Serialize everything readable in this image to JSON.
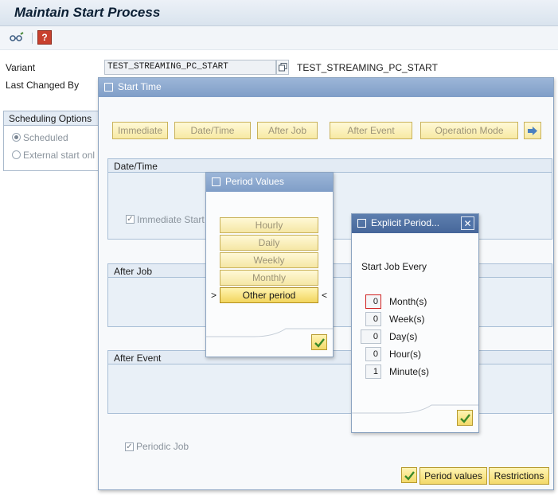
{
  "window": {
    "title": "Maintain Start Process"
  },
  "toolbar": {
    "icons": [
      "glasses-icon",
      "help-icon"
    ],
    "help_glyph": "?"
  },
  "form": {
    "variant_label": "Variant",
    "variant_value": "TEST_STREAMING_PC_START",
    "variant_desc": "TEST_STREAMING_PC_START",
    "last_changed_label": "Last Changed By"
  },
  "scheduling": {
    "header": "Scheduling Options",
    "options": [
      "Scheduled",
      "External start onl"
    ]
  },
  "start_time": {
    "title": "Start Time",
    "buttons": [
      "Immediate",
      "Date/Time",
      "After Job",
      "After Event",
      "Operation Mode"
    ],
    "groups": {
      "datetime": "Date/Time",
      "afterjob": "After Job",
      "afterevent": "After Event"
    },
    "immediate_start": "Immediate Start",
    "periodic_job": "Periodic Job",
    "footer_buttons": {
      "period_values": "Period values",
      "restrictions": "Restrictions"
    }
  },
  "period_values": {
    "title": "Period Values",
    "options": [
      "Hourly",
      "Daily",
      "Weekly",
      "Monthly",
      "Other period"
    ],
    "selected_markers": {
      "left": ">",
      "right": "<"
    }
  },
  "explicit_period": {
    "title": "Explicit Period...",
    "prompt": "Start Job Every",
    "rows": [
      {
        "value": "0",
        "unit": "Month(s)"
      },
      {
        "value": "0",
        "unit": "Week(s)"
      },
      {
        "value": "0",
        "unit": "Day(s)"
      },
      {
        "value": "0",
        "unit": "Hour(s)"
      },
      {
        "value": "1",
        "unit": "Minute(s)"
      }
    ]
  },
  "colors": {
    "title_bar": "#7f9ec7",
    "button_yellow": "#f3d96a",
    "focus_red": "#d02020"
  }
}
